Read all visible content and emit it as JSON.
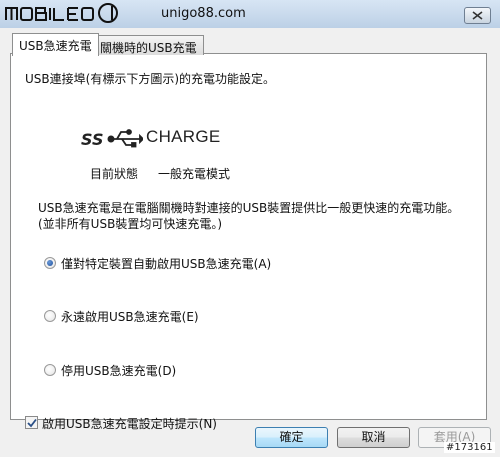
{
  "window": {
    "logo_text": "MOBILE01",
    "title": "unigo88.com"
  },
  "tabs": [
    {
      "label": "USB急速充電",
      "active": true
    },
    {
      "label": "關機時的USB充電",
      "active": false
    }
  ],
  "panel": {
    "intro": "USB連接埠(有標示下方圖示)的充電功能設定。",
    "charge_icon_label": "CHARGE",
    "status_label": "目前狀態",
    "status_value": "一般充電模式",
    "description_line1": "USB急速充電是在電腦關機時對連接的USB裝置提供比一般更快速的充電功能。",
    "description_line2": "(並非所有USB裝置均可快速充電。)",
    "options": [
      {
        "label": "僅對特定裝置自動啟用USB急速充電(A)",
        "selected": true
      },
      {
        "label": "永遠啟用USB急速充電(E)",
        "selected": false
      },
      {
        "label": "停用USB急速充電(D)",
        "selected": false
      }
    ],
    "checkbox": {
      "label": "啟用USB急速充電設定時提示(N)",
      "checked": true
    }
  },
  "buttons": {
    "ok": "確定",
    "cancel": "取消",
    "apply": "套用(A)"
  },
  "watermark": "#173161",
  "colors": {
    "titlebar": "#c7d8ea",
    "radio_selected": "#1d4f9c",
    "ok_button": "#bee6fd"
  }
}
